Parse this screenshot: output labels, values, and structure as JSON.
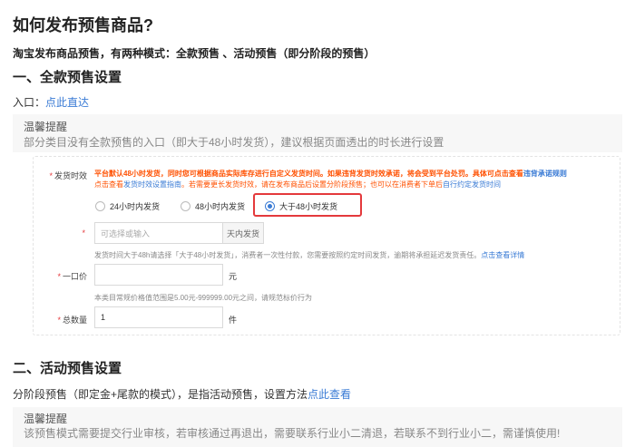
{
  "title": "如何发布预售商品?",
  "intro": "淘宝发布商品预售，有两种模式：全款预售 、活动预售（即分阶段的预售）",
  "section1": {
    "heading": "一、全款预售设置",
    "entry_prefix": "入口：",
    "entry_link": "点此直达",
    "tip_title": "温馨提醒",
    "tip_text": "部分类目没有全款预售的入口（即大于48小时发货），建议根据页面透出的时长进行设置"
  },
  "form": {
    "ship_time_label": "发货时效",
    "notice_line1": "平台默认48小时发货，同时您可根据商品实际库存进行自定义发货时间。如果违背发货时效承诺，将会受到平台处罚。具体可点击查看",
    "notice_line1_link": "违背承诺规则",
    "notice_line2_a": "点击查看",
    "notice_line2_link": "发货时效设置指南",
    "notice_line2_b": "。若需要更长发货时效，请在发布商品后设置分阶段预售；也可以在消费者下单后",
    "notice_line2_link2": "自行约定发货时间",
    "options": [
      "24小时内发货",
      "48小时内发货",
      "大于48小时发货"
    ],
    "selected_option": "大于48小时发货",
    "days_placeholder": "可选择或输入",
    "days_suffix": "天内发货",
    "days_hint_a": "发货时间大于48h请选择「大于48小时发货」，消费者一次性付款，您需要按照约定时间发货，逾期将承担延迟发货责任。",
    "days_hint_link": "点击查看详情",
    "price_label": "一口价",
    "price_unit": "元",
    "price_hint": "本类目常规价格值范围是5.00元-999999.00元之间，请规范标价行为",
    "qty_label": "总数量",
    "qty_value": "1",
    "qty_unit": "件"
  },
  "section2": {
    "heading": "二、活动预售设置",
    "para_text": "分阶段预售（即定金+尾款的模式），是指活动预售，设置方法",
    "para_link": "点此查看",
    "tip_title": "温馨提醒",
    "tip_text": "该预售模式需要提交行业审核，若审核通过再退出，需要联系行业小二清退，若联系不到行业小二，需谨慎使用!"
  },
  "colors": {
    "link": "#3a7bd5",
    "warning": "#ff5000",
    "highlight_border": "#e4393c"
  }
}
